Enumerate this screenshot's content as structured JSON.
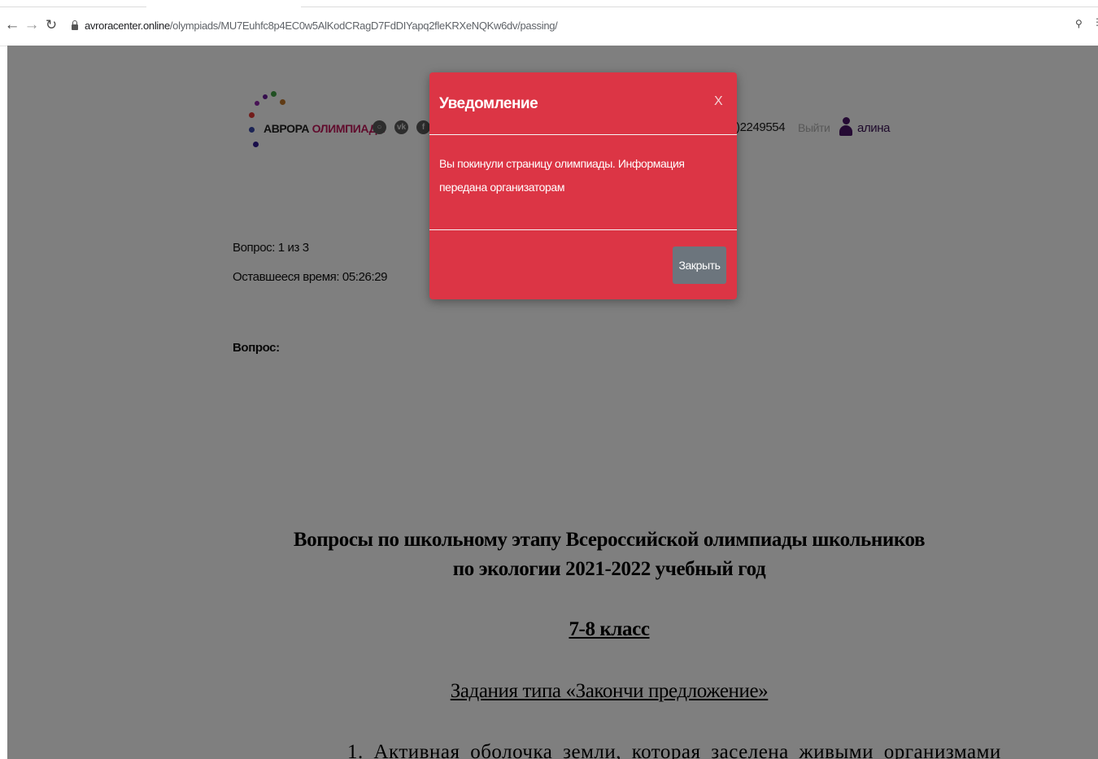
{
  "browser": {
    "url_host": "avroracenter.online",
    "url_path": "/olympiads/MU7Euhfc8p4EC0w5AlKodCRagD7FdDIYapq2fleKRXeNQKw6dv/passing/",
    "icons": [
      "back-arrow-icon",
      "forward-arrow-icon",
      "reload-icon",
      "lock-icon",
      "key-icon",
      "more-icon"
    ]
  },
  "header": {
    "logo_part1": "АВРОРА",
    "logo_part2": "ОЛИМПИАДА",
    "logo_dot_colors": [
      "#8e24aa",
      "#43a047",
      "#c0762a",
      "#e53935",
      "#d81b60",
      "#3949ab",
      "#311b92"
    ],
    "phone_visible": ")2249554",
    "logout": "Выйти",
    "username": "алина"
  },
  "quiz": {
    "counter": "Вопрос: 1 из 3",
    "timer": "Оставшееся время: 05:26:29",
    "question_label": "Вопрос:"
  },
  "document": {
    "title_line1": "Вопросы по школьному этапу Всероссийской олимпиады школьников",
    "title_line2": "по экологии 2021-2022 учебный год",
    "grade": "7-8 класс",
    "task_type": "Задания типа «Закончи предложение»",
    "item1": "1. Активная оболочка земли, которая заселена живыми организмами"
  },
  "modal": {
    "title": "Уведомление",
    "close_symbol": "X",
    "message": "Вы покинули страницу олимпиады. Информация передана организаторам",
    "button": "Закрыть",
    "background_color": "#dc3545",
    "button_color": "#6c757d"
  }
}
